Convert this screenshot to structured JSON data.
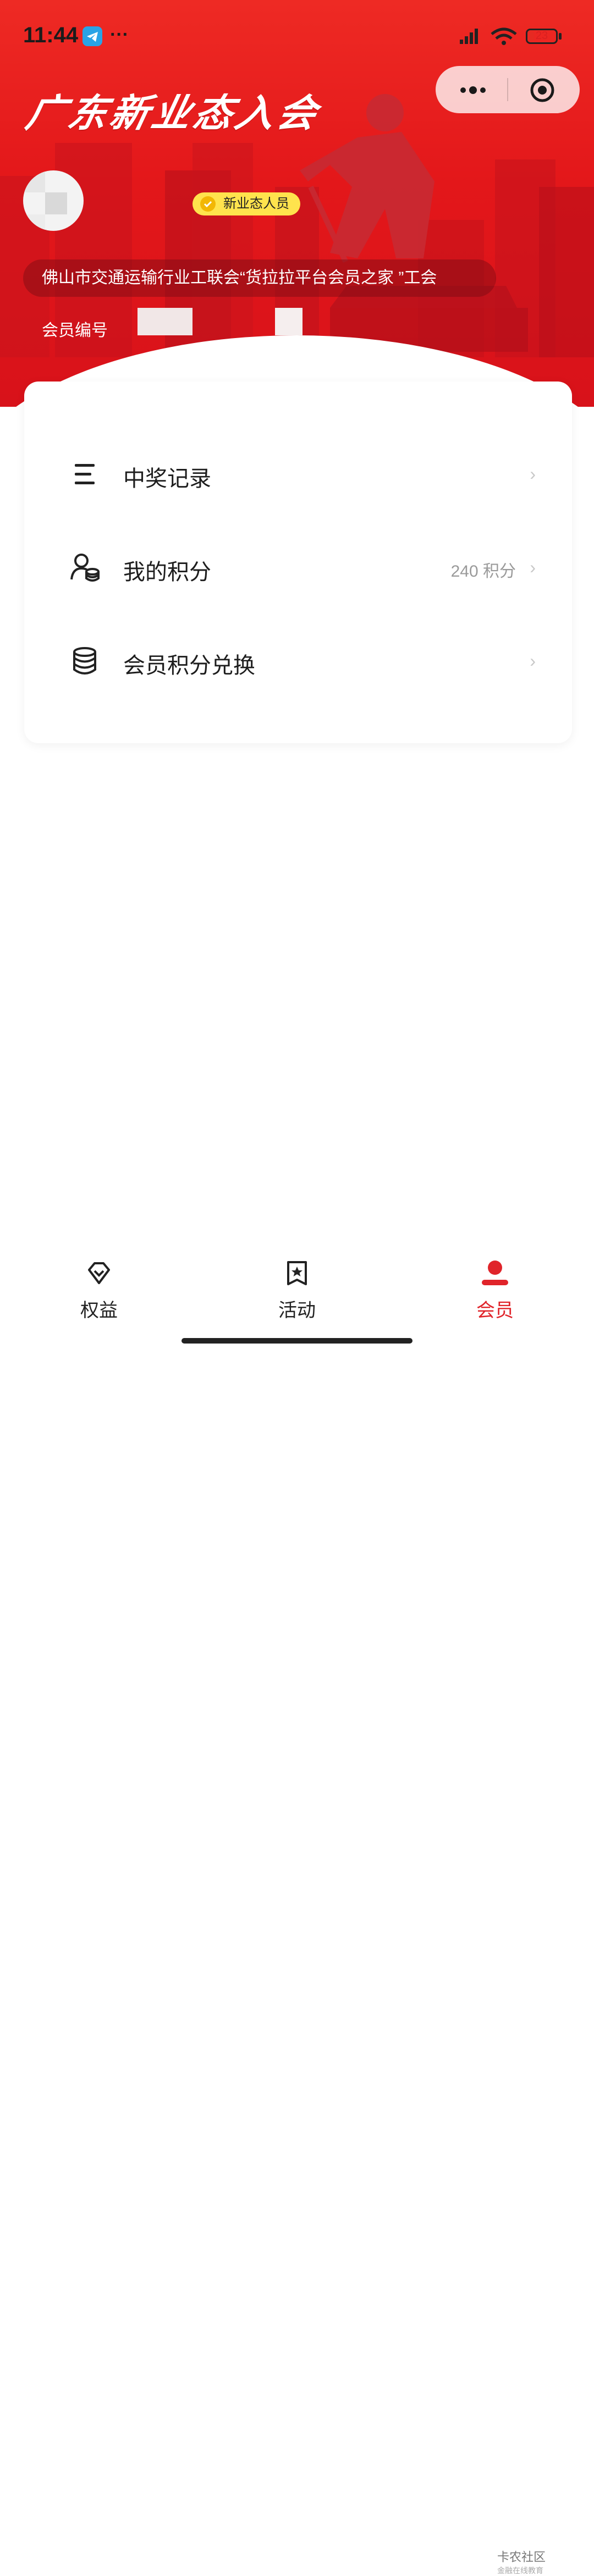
{
  "status_bar": {
    "time": "11:44",
    "dots": "···",
    "battery": "23",
    "icons": [
      "telegram-icon",
      "signal-icon",
      "wifi-icon",
      "battery-icon"
    ]
  },
  "capsule": {
    "more_icon": "more-dots-icon",
    "close_icon": "target-close-icon"
  },
  "header": {
    "title": "广东新业态入会",
    "badge": "新业态人员",
    "organization": "佛山市交通运输行业工联会“货拉拉平台会员之家 ”工会",
    "member_no_label": "会员编号"
  },
  "menu": [
    {
      "label": "中奖记录",
      "value": "",
      "icon": "list-icon"
    },
    {
      "label": "我的积分",
      "value": "240 积分",
      "icon": "user-coins-icon"
    },
    {
      "label": "会员积分兑换",
      "value": "",
      "icon": "database-icon"
    }
  ],
  "tabs": [
    {
      "label": "权益",
      "icon": "diamond-heart-icon",
      "active": false
    },
    {
      "label": "活动",
      "icon": "bookmark-star-icon",
      "active": false
    },
    {
      "label": "会员",
      "icon": "person-icon",
      "active": true
    }
  ],
  "watermark": {
    "title": "卡农社区",
    "subtitle": "金融在线教育"
  },
  "colors": {
    "primary": "#e3171a",
    "badge": "#ffe34d",
    "active_tab": "#e0242a"
  }
}
